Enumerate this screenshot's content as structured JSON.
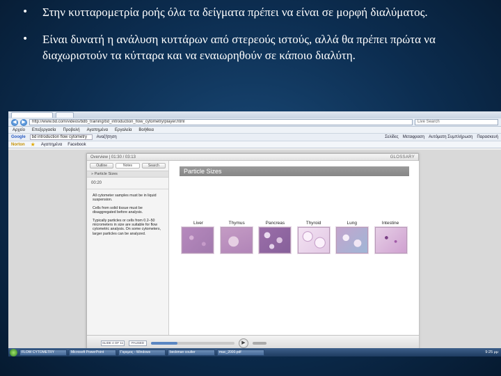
{
  "slide": {
    "bullets": [
      {
        "symbol": "•",
        "text": "Στην κυτταρομετρία ροής όλα τα δείγματα πρέπει να είναι σε μορφή διαλύματος."
      },
      {
        "symbol": "•",
        "text": "Είναι δυνατή η ανάλυση κυττάρων από στερεούς ιστούς, αλλά θα πρέπει πρώτα να διαχωριστούν τα κύτταρα και να εναιωρηθούν σε κάποιο διαλύτη."
      }
    ]
  },
  "browser": {
    "url": "http://www.bd.com/videos/bdb_training/bd_introduction_flow_cytometry/player.html",
    "search_placeholder": "Live Search",
    "menu": [
      "Αρχείο",
      "Επεξεργασία",
      "Προβολή",
      "Αγαπημένα",
      "Εργαλεία",
      "Βοήθεια"
    ],
    "toolbar": {
      "google_label": "Google",
      "google_query": "bd introduction flow cytometry",
      "search_button": "Αναζήτηση",
      "right_items": [
        "Σελίδες",
        "Μεταφραση",
        "Αυτόματη Συμπλήρωση",
        "Παρασκευή"
      ]
    },
    "favorites": [
      "Norton",
      "Αγαπημένα",
      "Facebook"
    ]
  },
  "player": {
    "header_left": "Overview  |  01:30 / 03:13",
    "glossary": "GLOSSARY",
    "panel_tabs": [
      "Outline",
      "Notes",
      "Search"
    ],
    "outline_item": "» Particle Sizes",
    "time": "00:20",
    "notes": [
      "All cytometer samples must be in liquid suspension.",
      "Cells from solid tissue must be disaggregated before analysis.",
      "Typically particles or cells from 0.2–50 micrometers in size are suitable for flow cytometric analysis. On some cytometers, larger particles can be analyzed."
    ],
    "slide_title": "Particle Sizes",
    "tissues": [
      "Liver",
      "Thymus",
      "Pancreas",
      "Thyroid",
      "Lung",
      "Intestine"
    ],
    "controls": {
      "slide_counter": "SLIDE 4 OF 11",
      "status": "PAUSED",
      "seek_progress": 0.32
    }
  },
  "taskbar": {
    "tasks": [
      "FLOW CYTOMETRY",
      "Microsoft PowerPoint",
      "Γκρεμος - Windows",
      "beckman coulter",
      "mac_2000.pdf"
    ],
    "clock": "9:25 μμ"
  }
}
